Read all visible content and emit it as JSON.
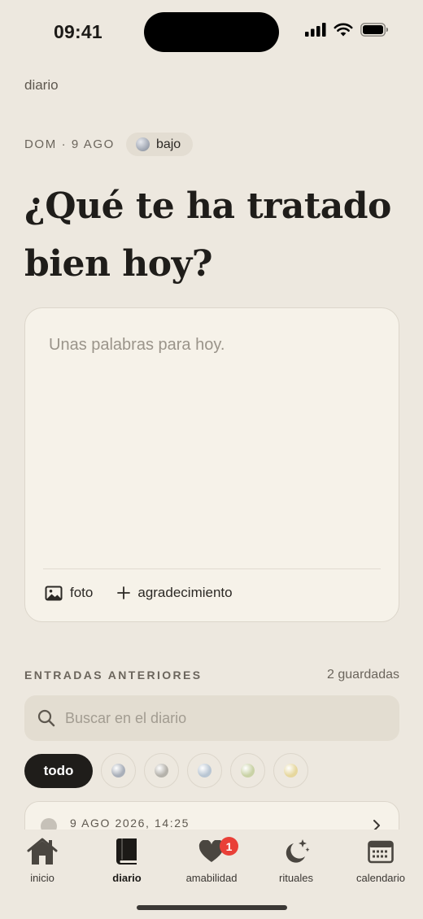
{
  "status_bar": {
    "time": "09:41"
  },
  "section_label": "diario",
  "entry_date": {
    "date": "DOM · 9 AGO",
    "mood_label": "bajo"
  },
  "prompt": "¿Qué te ha tratado bien hoy?",
  "composer": {
    "placeholder": "Unas palabras para hoy.",
    "photo_label": "foto",
    "gratitude_label": "agradecimiento"
  },
  "previous": {
    "title": "ENTRADAS ANTERIORES",
    "count": "2 guardadas",
    "search_placeholder": "Buscar en el diario",
    "filter_all_label": "todo",
    "filter_orbs": [
      "#a9afb9",
      "#b5b2ab",
      "#b9c6d3",
      "#c9d2a6",
      "#e6d79e"
    ],
    "entries": [
      {
        "datetime": "9 AGO 2026, 14:25"
      }
    ]
  },
  "tabs": [
    {
      "label": "inicio",
      "icon": "home-icon"
    },
    {
      "label": "diario",
      "icon": "journal-book-icon",
      "active": true
    },
    {
      "label": "amabilidad",
      "icon": "heart-icon",
      "badge": "1"
    },
    {
      "label": "rituales",
      "icon": "moon-sparkle-icon"
    },
    {
      "label": "calendario",
      "icon": "calendar-icon"
    }
  ],
  "colors": {
    "background": "#ede8df",
    "card": "#f6f2e9",
    "accent_dark": "#1f1d1a",
    "badge": "#e94038"
  }
}
